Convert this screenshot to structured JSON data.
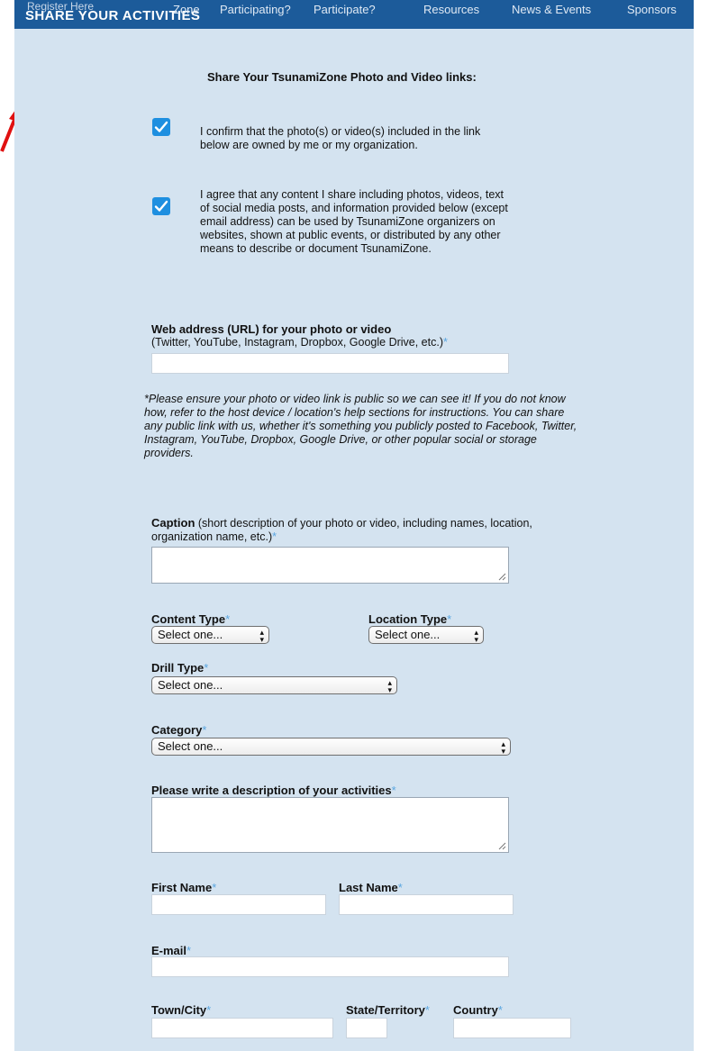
{
  "nav": {
    "title": "SHARE YOUR ACTIVITIES",
    "ghost": "Register Here",
    "items": [
      "Zone",
      "Participating?",
      "Participate?",
      "Resources",
      "News & Events",
      "Sponsors"
    ]
  },
  "form": {
    "heading": "Share Your TsunamiZone Photo and Video links:",
    "confirm_text": "I confirm that the photo(s) or video(s) included in the link below are owned by me or my organization.",
    "agree_text": "I agree that any content I share including photos, videos, text of social media posts, and information provided below (except email address) can be used by TsunamiZone organizers on websites, shown at public events, or distributed by any other means to describe or document TsunamiZone.",
    "url_label": "Web address (URL) for your photo or video",
    "url_sublabel": "(Twitter, YouTube, Instagram, Dropbox, Google Drive, etc.)",
    "public_note": "*Please ensure your photo or video link is public so we can see it! If you do not know how, refer to the host device / location's help sections for instructions. You can share any public link with us, whether it's something you publicly posted to Facebook, Twitter, Instagram, YouTube, Dropbox, Google Drive, or other popular social or storage providers.",
    "caption_label": "Caption",
    "caption_sublabel": " (short description of your photo or video, including names, location, organization name, etc.)",
    "content_type_label": "Content Type",
    "location_type_label": "Location Type",
    "drill_type_label": "Drill Type",
    "category_label": "Category",
    "select_placeholder_short": "Select one...",
    "select_placeholder": "Select one...",
    "description_label": "Please write a description of your activities",
    "first_name_label": "First Name",
    "last_name_label": "Last Name",
    "email_label": "E-mail",
    "town_label": "Town/City",
    "state_label": "State/Territory",
    "country_label": "Country",
    "required_mark": "*"
  },
  "colors": {
    "nav_bg": "#1c5b9a",
    "form_bg": "#d4e3f0",
    "checkbox": "#1e8fe0",
    "required": "#5aa6e0",
    "annotation_arrow": "#e01010"
  }
}
